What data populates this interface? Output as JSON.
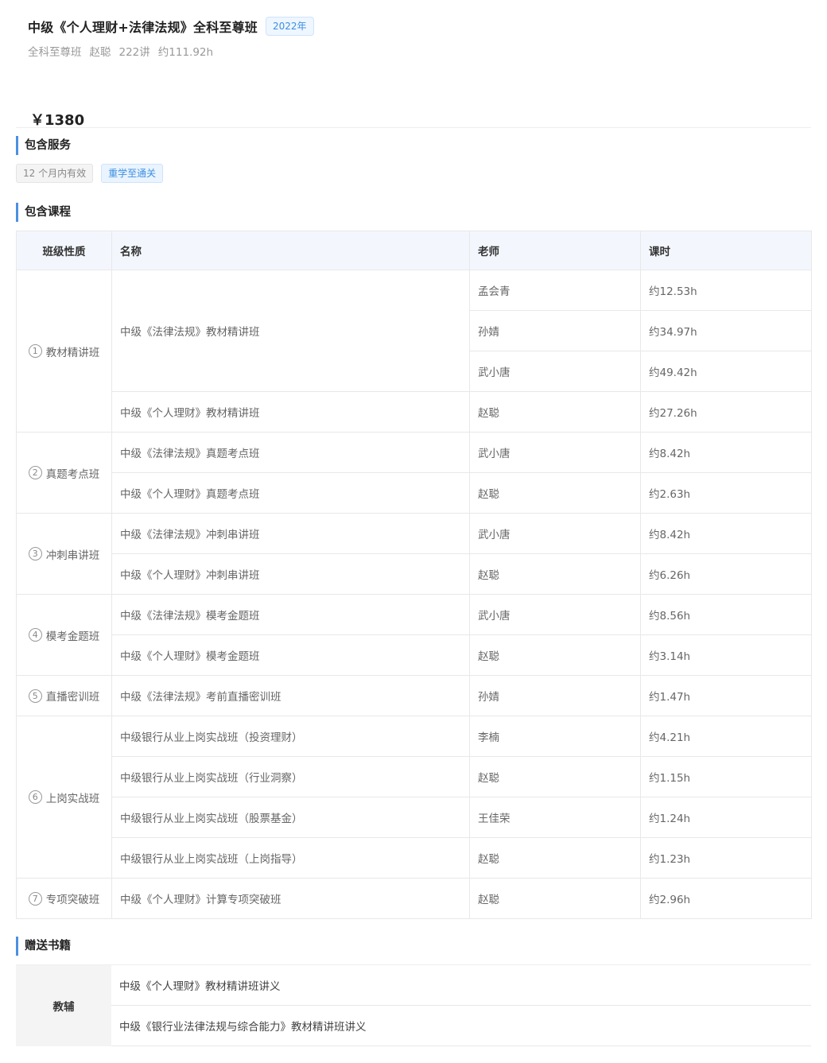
{
  "product": {
    "title": "中级《个人理财+法律法规》全科至尊班",
    "year_badge": "2022年",
    "meta": [
      "全科至尊班",
      "赵聪",
      "222讲",
      "约111.92h"
    ],
    "price": "￥1380"
  },
  "services": {
    "section_title": "包含服务",
    "tags": [
      "12 个月内有效",
      "重学至通关"
    ]
  },
  "courses": {
    "section_title": "包含课程",
    "headers": {
      "type": "班级性质",
      "name": "名称",
      "teacher": "老师",
      "hours": "课时"
    },
    "groups": [
      {
        "index": "1",
        "type": "教材精讲班",
        "items": [
          {
            "name": "中级《法律法规》教材精讲班",
            "teachers": [
              {
                "teacher": "孟会青",
                "hours": "约12.53h"
              },
              {
                "teacher": "孙婧",
                "hours": "约34.97h"
              },
              {
                "teacher": "武小唐",
                "hours": "约49.42h"
              }
            ]
          },
          {
            "name": "中级《个人理财》教材精讲班",
            "teachers": [
              {
                "teacher": "赵聪",
                "hours": "约27.26h"
              }
            ]
          }
        ]
      },
      {
        "index": "2",
        "type": "真题考点班",
        "items": [
          {
            "name": "中级《法律法规》真题考点班",
            "teachers": [
              {
                "teacher": "武小唐",
                "hours": "约8.42h"
              }
            ]
          },
          {
            "name": "中级《个人理财》真题考点班",
            "teachers": [
              {
                "teacher": "赵聪",
                "hours": "约2.63h"
              }
            ]
          }
        ]
      },
      {
        "index": "3",
        "type": "冲刺串讲班",
        "items": [
          {
            "name": "中级《法律法规》冲刺串讲班",
            "teachers": [
              {
                "teacher": "武小唐",
                "hours": "约8.42h"
              }
            ]
          },
          {
            "name": "中级《个人理财》冲刺串讲班",
            "teachers": [
              {
                "teacher": "赵聪",
                "hours": "约6.26h"
              }
            ]
          }
        ]
      },
      {
        "index": "4",
        "type": "模考金题班",
        "items": [
          {
            "name": "中级《法律法规》模考金题班",
            "teachers": [
              {
                "teacher": "武小唐",
                "hours": "约8.56h"
              }
            ]
          },
          {
            "name": "中级《个人理财》模考金题班",
            "teachers": [
              {
                "teacher": "赵聪",
                "hours": "约3.14h"
              }
            ]
          }
        ]
      },
      {
        "index": "5",
        "type": "直播密训班",
        "items": [
          {
            "name": "中级《法律法规》考前直播密训班",
            "teachers": [
              {
                "teacher": "孙婧",
                "hours": "约1.47h"
              }
            ]
          }
        ]
      },
      {
        "index": "6",
        "type": "上岗实战班",
        "items": [
          {
            "name": "中级银行从业上岗实战班（投资理财）",
            "teachers": [
              {
                "teacher": "李楠",
                "hours": "约4.21h"
              }
            ]
          },
          {
            "name": "中级银行从业上岗实战班（行业洞察）",
            "teachers": [
              {
                "teacher": "赵聪",
                "hours": "约1.15h"
              }
            ]
          },
          {
            "name": "中级银行从业上岗实战班（股票基金）",
            "teachers": [
              {
                "teacher": "王佳荣",
                "hours": "约1.24h"
              }
            ]
          },
          {
            "name": "中级银行从业上岗实战班（上岗指导）",
            "teachers": [
              {
                "teacher": "赵聪",
                "hours": "约1.23h"
              }
            ]
          }
        ]
      },
      {
        "index": "7",
        "type": "专项突破班",
        "items": [
          {
            "name": "中级《个人理财》计算专项突破班",
            "teachers": [
              {
                "teacher": "赵聪",
                "hours": "约2.96h"
              }
            ]
          }
        ]
      }
    ]
  },
  "books": {
    "section_title": "赠送书籍",
    "category": "教辅",
    "items": [
      "中级《个人理财》教材精讲班讲义",
      "中级《银行业法律法规与综合能力》教材精讲班讲义"
    ]
  }
}
